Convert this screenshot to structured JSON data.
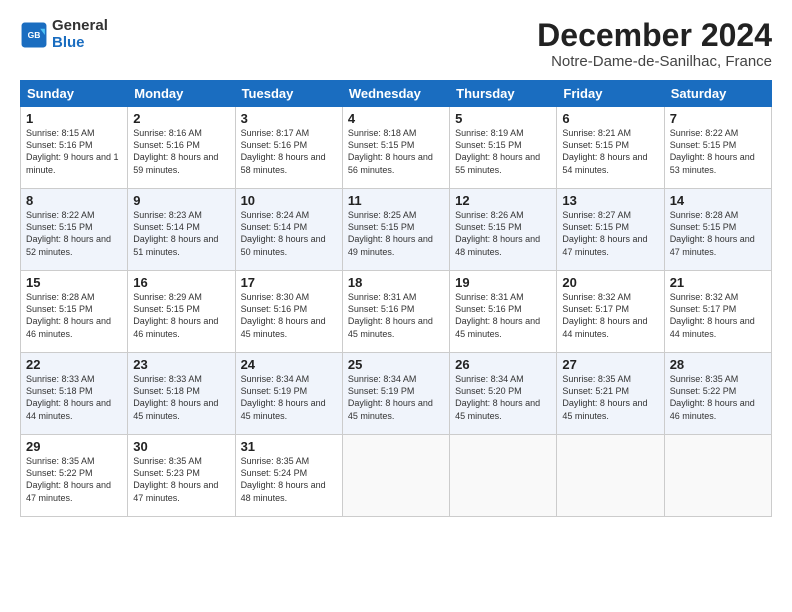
{
  "logo": {
    "line1": "General",
    "line2": "Blue"
  },
  "title": "December 2024",
  "location": "Notre-Dame-de-Sanilhac, France",
  "days_of_week": [
    "Sunday",
    "Monday",
    "Tuesday",
    "Wednesday",
    "Thursday",
    "Friday",
    "Saturday"
  ],
  "weeks": [
    [
      {
        "day": "1",
        "sunrise": "8:15 AM",
        "sunset": "5:16 PM",
        "daylight": "9 hours and 1 minute."
      },
      {
        "day": "2",
        "sunrise": "8:16 AM",
        "sunset": "5:16 PM",
        "daylight": "8 hours and 59 minutes."
      },
      {
        "day": "3",
        "sunrise": "8:17 AM",
        "sunset": "5:16 PM",
        "daylight": "8 hours and 58 minutes."
      },
      {
        "day": "4",
        "sunrise": "8:18 AM",
        "sunset": "5:15 PM",
        "daylight": "8 hours and 56 minutes."
      },
      {
        "day": "5",
        "sunrise": "8:19 AM",
        "sunset": "5:15 PM",
        "daylight": "8 hours and 55 minutes."
      },
      {
        "day": "6",
        "sunrise": "8:21 AM",
        "sunset": "5:15 PM",
        "daylight": "8 hours and 54 minutes."
      },
      {
        "day": "7",
        "sunrise": "8:22 AM",
        "sunset": "5:15 PM",
        "daylight": "8 hours and 53 minutes."
      }
    ],
    [
      {
        "day": "8",
        "sunrise": "8:22 AM",
        "sunset": "5:15 PM",
        "daylight": "8 hours and 52 minutes."
      },
      {
        "day": "9",
        "sunrise": "8:23 AM",
        "sunset": "5:14 PM",
        "daylight": "8 hours and 51 minutes."
      },
      {
        "day": "10",
        "sunrise": "8:24 AM",
        "sunset": "5:14 PM",
        "daylight": "8 hours and 50 minutes."
      },
      {
        "day": "11",
        "sunrise": "8:25 AM",
        "sunset": "5:15 PM",
        "daylight": "8 hours and 49 minutes."
      },
      {
        "day": "12",
        "sunrise": "8:26 AM",
        "sunset": "5:15 PM",
        "daylight": "8 hours and 48 minutes."
      },
      {
        "day": "13",
        "sunrise": "8:27 AM",
        "sunset": "5:15 PM",
        "daylight": "8 hours and 47 minutes."
      },
      {
        "day": "14",
        "sunrise": "8:28 AM",
        "sunset": "5:15 PM",
        "daylight": "8 hours and 47 minutes."
      }
    ],
    [
      {
        "day": "15",
        "sunrise": "8:28 AM",
        "sunset": "5:15 PM",
        "daylight": "8 hours and 46 minutes."
      },
      {
        "day": "16",
        "sunrise": "8:29 AM",
        "sunset": "5:15 PM",
        "daylight": "8 hours and 46 minutes."
      },
      {
        "day": "17",
        "sunrise": "8:30 AM",
        "sunset": "5:16 PM",
        "daylight": "8 hours and 45 minutes."
      },
      {
        "day": "18",
        "sunrise": "8:31 AM",
        "sunset": "5:16 PM",
        "daylight": "8 hours and 45 minutes."
      },
      {
        "day": "19",
        "sunrise": "8:31 AM",
        "sunset": "5:16 PM",
        "daylight": "8 hours and 45 minutes."
      },
      {
        "day": "20",
        "sunrise": "8:32 AM",
        "sunset": "5:17 PM",
        "daylight": "8 hours and 44 minutes."
      },
      {
        "day": "21",
        "sunrise": "8:32 AM",
        "sunset": "5:17 PM",
        "daylight": "8 hours and 44 minutes."
      }
    ],
    [
      {
        "day": "22",
        "sunrise": "8:33 AM",
        "sunset": "5:18 PM",
        "daylight": "8 hours and 44 minutes."
      },
      {
        "day": "23",
        "sunrise": "8:33 AM",
        "sunset": "5:18 PM",
        "daylight": "8 hours and 45 minutes."
      },
      {
        "day": "24",
        "sunrise": "8:34 AM",
        "sunset": "5:19 PM",
        "daylight": "8 hours and 45 minutes."
      },
      {
        "day": "25",
        "sunrise": "8:34 AM",
        "sunset": "5:19 PM",
        "daylight": "8 hours and 45 minutes."
      },
      {
        "day": "26",
        "sunrise": "8:34 AM",
        "sunset": "5:20 PM",
        "daylight": "8 hours and 45 minutes."
      },
      {
        "day": "27",
        "sunrise": "8:35 AM",
        "sunset": "5:21 PM",
        "daylight": "8 hours and 45 minutes."
      },
      {
        "day": "28",
        "sunrise": "8:35 AM",
        "sunset": "5:22 PM",
        "daylight": "8 hours and 46 minutes."
      }
    ],
    [
      {
        "day": "29",
        "sunrise": "8:35 AM",
        "sunset": "5:22 PM",
        "daylight": "8 hours and 47 minutes."
      },
      {
        "day": "30",
        "sunrise": "8:35 AM",
        "sunset": "5:23 PM",
        "daylight": "8 hours and 47 minutes."
      },
      {
        "day": "31",
        "sunrise": "8:35 AM",
        "sunset": "5:24 PM",
        "daylight": "8 hours and 48 minutes."
      },
      null,
      null,
      null,
      null
    ]
  ]
}
